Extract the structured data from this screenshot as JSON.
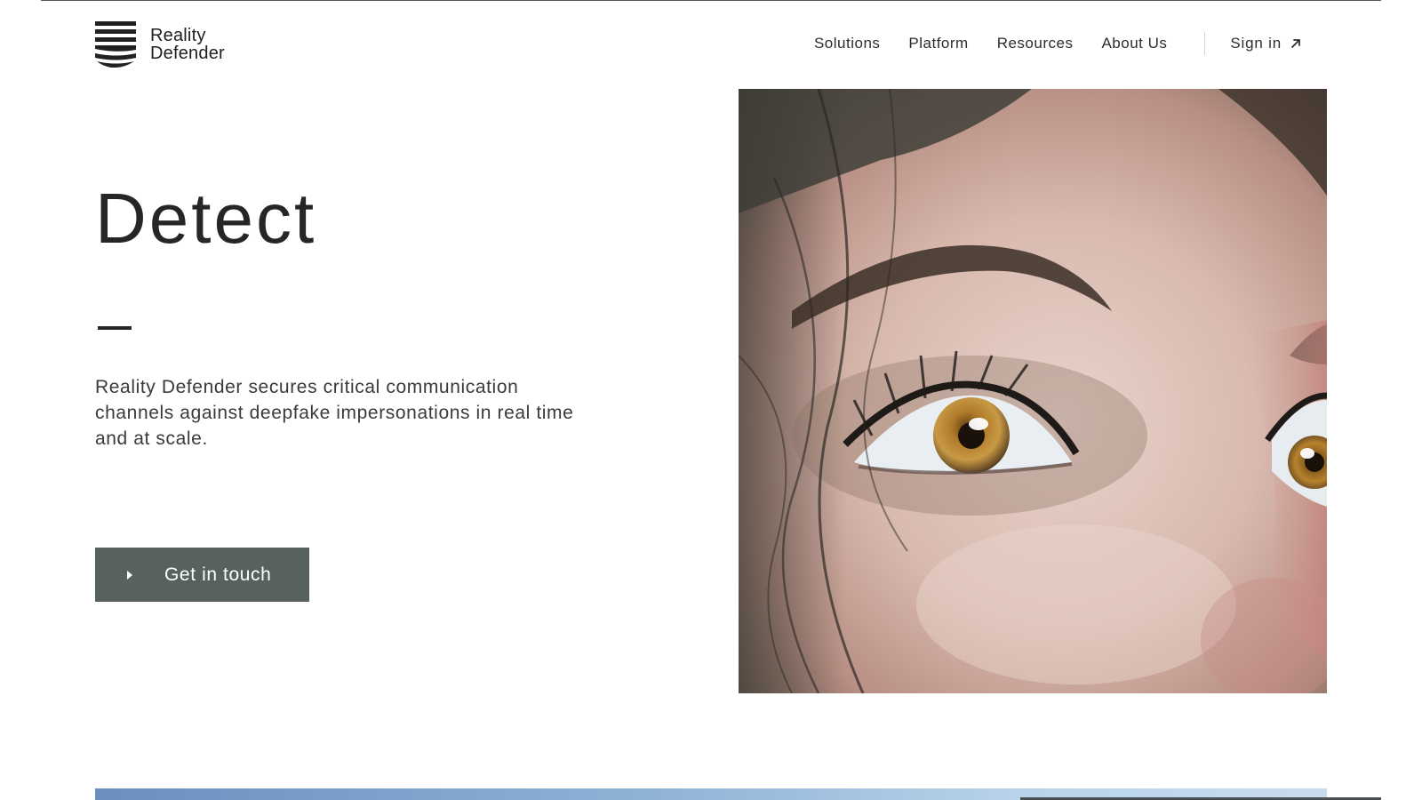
{
  "brand": {
    "name_line1": "Reality",
    "name_line2": "Defender",
    "logo_icon": "striped-shield-logo",
    "color_dark": "#1f1f1f"
  },
  "nav": {
    "items": [
      "Solutions",
      "Platform",
      "Resources",
      "About Us"
    ],
    "sign_in": "Sign in",
    "sign_in_icon": "arrow-up-right-icon"
  },
  "hero": {
    "title": "Detect",
    "description": "Reality Defender secures critical communication channels against deepfake impersonations in real time and at scale.",
    "cta_label": "Get in touch",
    "cta_icon": "play-triangle-icon",
    "cta_color": "#56625b",
    "image_subject": "close-up of woman's face with amber eye"
  }
}
